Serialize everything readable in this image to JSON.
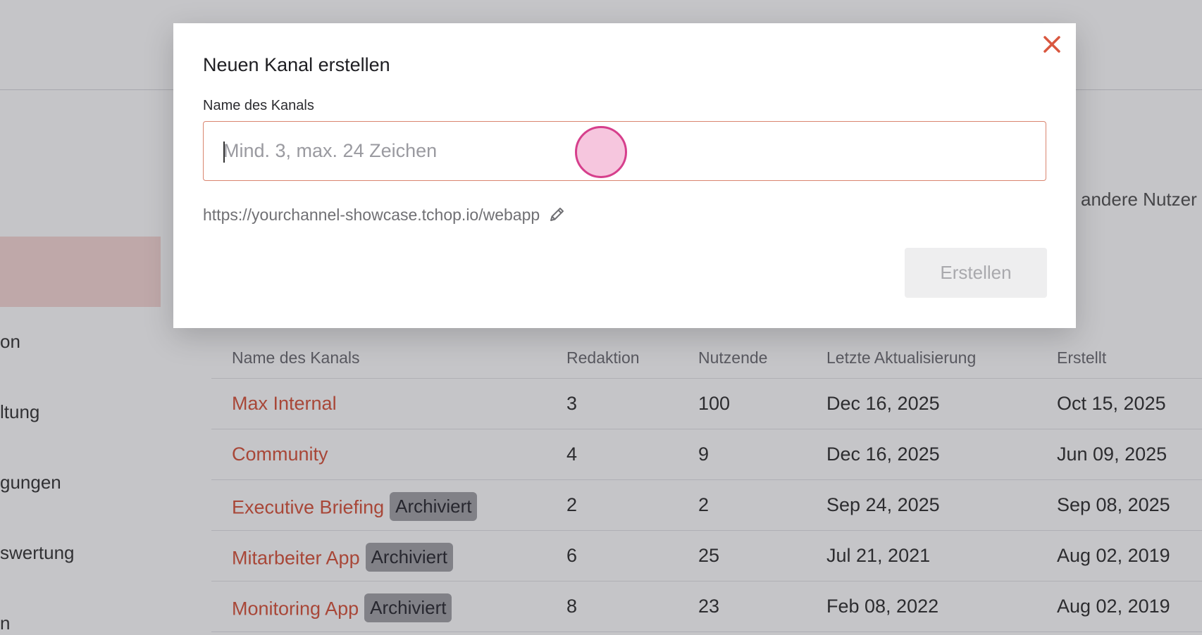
{
  "sidebar": {
    "items": [
      {
        "label": "on"
      },
      {
        "label": "ltung"
      },
      {
        "label": "gungen"
      },
      {
        "label": "swertung"
      },
      {
        "label": "n"
      }
    ]
  },
  "main": {
    "info_text": "andere Nutzer"
  },
  "table": {
    "headers": [
      "Name des Kanals",
      "Redaktion",
      "Nutzende",
      "Letzte Aktualisierung",
      "Erstellt"
    ],
    "rows": [
      {
        "name": "Max Internal",
        "badge": "",
        "editors": "3",
        "users": "100",
        "updated": "Dec 16, 2025",
        "created": "Oct 15, 2025"
      },
      {
        "name": "Community",
        "badge": "",
        "editors": "4",
        "users": "9",
        "updated": "Dec 16, 2025",
        "created": "Jun 09, 2025"
      },
      {
        "name": "Executive Briefing",
        "badge": "Archiviert",
        "editors": "2",
        "users": "2",
        "updated": "Sep 24, 2025",
        "created": "Sep 08, 2025"
      },
      {
        "name": "Mitarbeiter App",
        "badge": "Archiviert",
        "editors": "6",
        "users": "25",
        "updated": "Jul 21, 2021",
        "created": "Aug 02, 2019"
      },
      {
        "name": "Monitoring App",
        "badge": "Archiviert",
        "editors": "8",
        "users": "23",
        "updated": "Feb 08, 2022",
        "created": "Aug 02, 2019"
      }
    ]
  },
  "modal": {
    "title": "Neuen Kanal erstellen",
    "field_label": "Name des Kanals",
    "input_value": "",
    "input_placeholder": "Mind. 3, max. 24 Zeichen",
    "url": "https://yourchannel-showcase.tchop.io/webapp",
    "create_label": "Erstellen",
    "close_icon": "close-icon",
    "edit_icon": "pencil-icon"
  },
  "colors": {
    "accent": "#d9573f",
    "close": "#d9573f",
    "input_border": "#d9856f",
    "badge_bg": "#a4a4a8"
  }
}
